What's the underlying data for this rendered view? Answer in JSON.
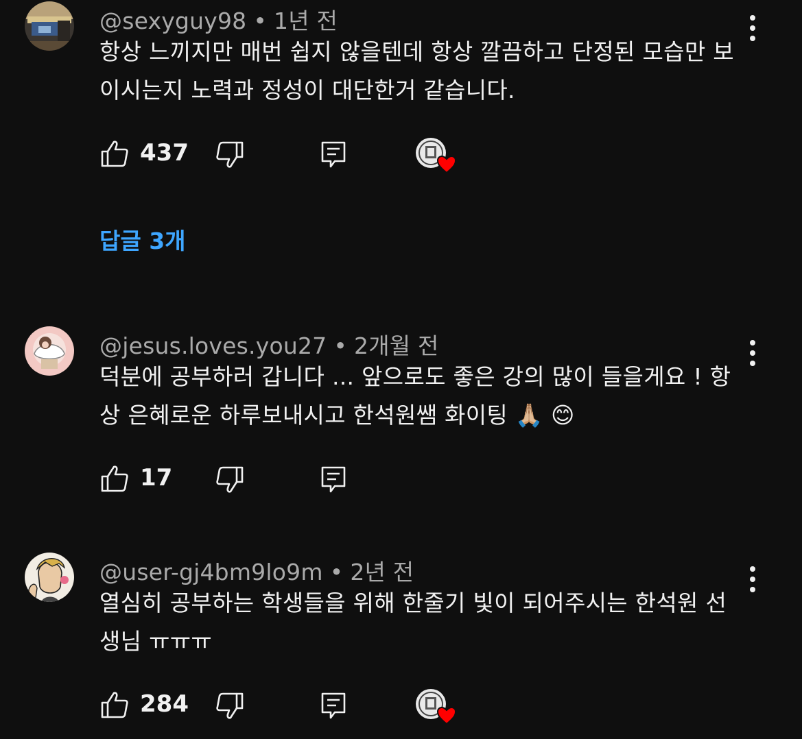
{
  "colors": {
    "background": "#0f0f0f",
    "text": "#f1f1f1",
    "meta": "#aaaaaa",
    "link": "#3ea6ff",
    "heart": "#ff0000"
  },
  "comments": [
    {
      "author": "@sexyguy98",
      "time": "1년 전",
      "text": "항상 느끼지만 매번 쉽지 않을텐데 항상 깔끔하고 단정된 모습만 보이시는지 노력과 정성이 대단한거 같습니다.",
      "likes": "437",
      "creator_heart": true,
      "replies_label": "답글 3개",
      "icons": [
        "thumbs-up-icon",
        "thumbs-down-icon",
        "reply-icon",
        "more-vertical-icon"
      ]
    },
    {
      "author": "@jesus.loves.you27",
      "time": "2개월 전",
      "text": "덕분에 공부하러 갑니다 ... 앞으로도 좋은 강의 많이 들을게요 ! 항상 은혜로운 하루보내시고 한석원쌤 화이팅 🙏🏼 😊",
      "likes": "17",
      "creator_heart": false
    },
    {
      "author": "@user-gj4bm9lo9m",
      "time": "2년 전",
      "text": "열심히 공부하는 학생들을 위해 한줄기 빛이 되어주시는 한석원 선생님 ㅠㅠㅠ",
      "likes": "284",
      "creator_heart": true
    }
  ]
}
